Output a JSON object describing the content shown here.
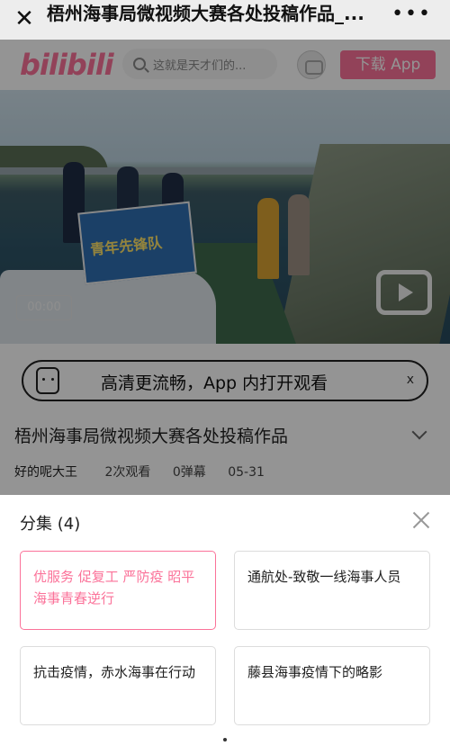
{
  "webview": {
    "close_icon": "close-icon",
    "title": "梧州海事局微视频大赛各处投稿作品_...",
    "more_icon": "more-icon"
  },
  "header": {
    "logo": "bilibili",
    "search_placeholder": "这就是天才们的...",
    "download_label": "下载 App"
  },
  "video": {
    "banner_text": "青年先锋队",
    "time": "00:00"
  },
  "app_banner": {
    "text": "高清更流畅，App 内打开观看",
    "close": "x"
  },
  "info": {
    "title": "梧州海事局微视频大赛各处投稿作品",
    "uploader": "好的呢大王",
    "views": "2次观看",
    "danmaku": "0弹幕",
    "date": "05-31"
  },
  "episodes": {
    "title": "分集 (4)",
    "items": [
      {
        "label": "优服务 促复工 严防疫 昭平海事青春逆行",
        "active": true
      },
      {
        "label": "通航处-致敬一线海事人员",
        "active": false
      },
      {
        "label": "抗击疫情，赤水海事在行动",
        "active": false
      },
      {
        "label": "藤县海事疫情下的略影",
        "active": false
      }
    ]
  },
  "colors": {
    "brand": "#fb7299",
    "overlay": "rgba(0,0,0,0.42)"
  }
}
